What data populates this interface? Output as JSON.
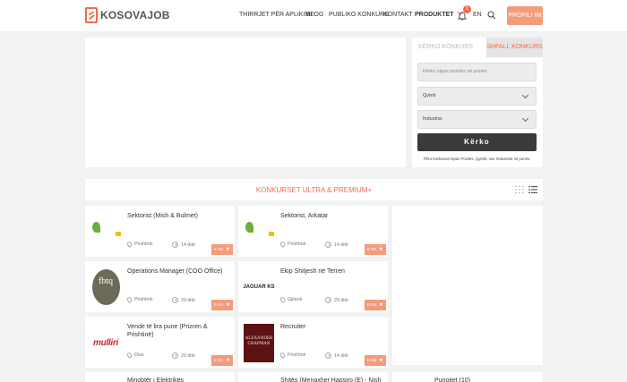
{
  "header": {
    "logo_text": "KOSOVAJOB",
    "nav": [
      "THIRRJET PËR APLIKIME",
      "BLOG",
      "PUBLIKO KONKURS",
      "KONTAKT",
      "PRODUKTET"
    ],
    "notification_count": "1",
    "language": "EN",
    "profile_label": "PROFILI IM"
  },
  "search": {
    "tab_search": "KËRKO KONKURS",
    "tab_more": "SHFALL KONKURS",
    "keyword_placeholder": "Kërko sipas pozitës së punës",
    "city_label": "Qyteti",
    "industry_label": "Industria",
    "button_label": "Kërko",
    "hint": "Filtro konkurset sipas Pozitës, Qytetit, ose Industrisë së punës."
  },
  "section": {
    "title": "KONKURSET ULTRA & PREMIUM+"
  },
  "jobs": [
    {
      "title": "Sektorist (Mish & Bulmet)",
      "location": "Prishtinë",
      "days": "14 ditë",
      "tag": "E RE",
      "logo": "ambient-leaf-logo"
    },
    {
      "title": "Sektorist, Arkatar",
      "location": "Prishtinë",
      "days": "14 ditë",
      "tag": "E RE",
      "logo": "ambient-leaf-logo"
    },
    {
      "title": "Operations Manager (COO Office)",
      "location": "Prishtinë",
      "days": "29 ditë",
      "tag": "E RE",
      "logo": "fbtq"
    },
    {
      "title": "Ekip Shitjesh në Terren",
      "location": "Gjilanë",
      "days": "29 ditë",
      "tag": "E RE",
      "logo": "JAGUAR KS"
    },
    {
      "title": "Vende të lira pune (Prizren & Prishtinë)",
      "location": "Disa",
      "days": "29 ditë",
      "tag": "E RE",
      "logo": "mulliri"
    },
    {
      "title": "Recruiter",
      "location": "Prishtinë",
      "days": "14 ditë",
      "tag": "E RE",
      "logo": "ALEXANDER CHAPMAN"
    }
  ],
  "row4": [
    "Minobtër i Elektrikës",
    "Shitës (Menaxher Hapsiro (E) - Nish",
    "Punojtet (10)"
  ],
  "logos": {
    "fbtq_text": "fbtq",
    "ac_text": "ALEXANDER CHAPMAN"
  },
  "colors": {
    "accent": "#ef6b4a",
    "button_dark": "#3a3a3a"
  }
}
